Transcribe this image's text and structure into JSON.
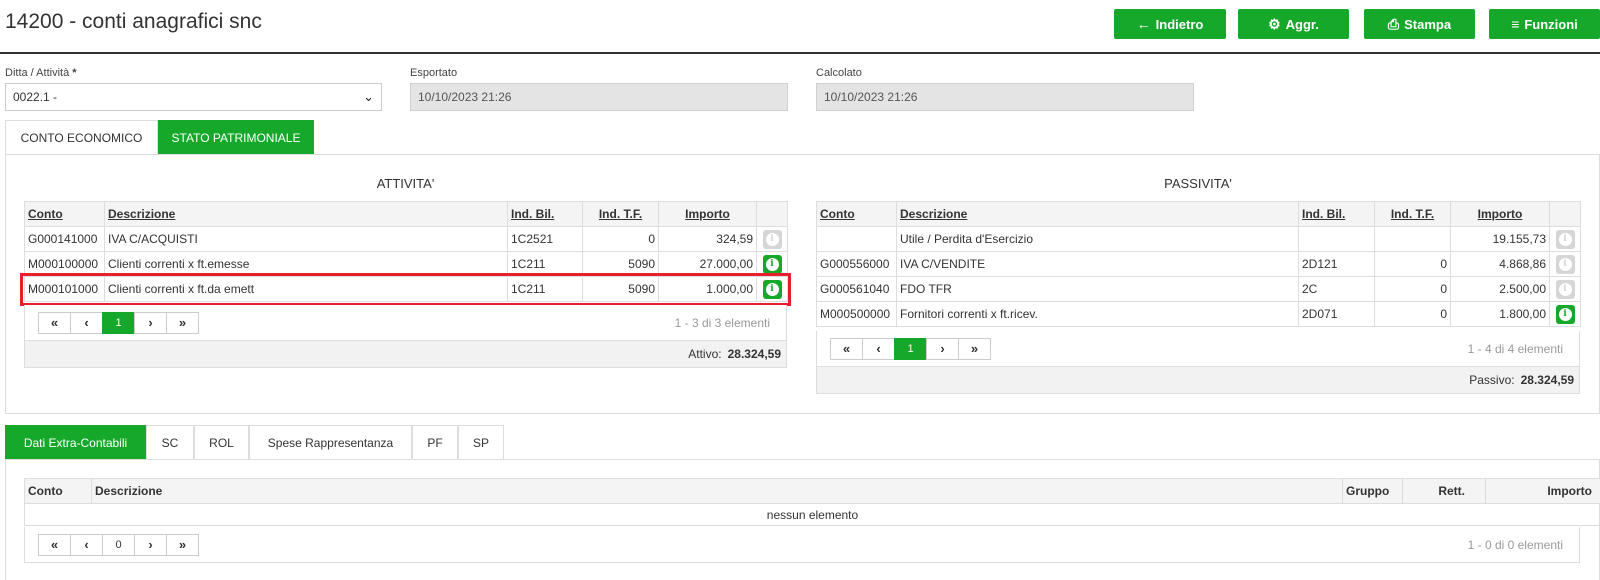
{
  "header": {
    "title": "14200 - conti anagrafici snc",
    "buttons": [
      {
        "icon": "arrow-left-icon",
        "label": "Indietro"
      },
      {
        "icon": "gears-icon",
        "label": "Aggr."
      },
      {
        "icon": "print-icon",
        "label": "Stampa"
      },
      {
        "icon": "bars-icon",
        "label": "Funzioni"
      }
    ]
  },
  "fields": {
    "ditta": {
      "label": "Ditta / Attività",
      "required": "*",
      "value": "0022.1 -"
    },
    "esportato": {
      "label": "Esportato",
      "value": "10/10/2023 21:26"
    },
    "calcolato": {
      "label": "Calcolato",
      "value": "10/10/2023 21:26"
    }
  },
  "tabs": [
    "CONTO ECONOMICO",
    "STATO PATRIMONIALE"
  ],
  "active_tab": "STATO PATRIMONIALE",
  "attivita": {
    "title": "ATTIVITA'",
    "columns": [
      "Conto",
      "Descrizione",
      "Ind. Bil.",
      "Ind. T.F.",
      "Importo"
    ],
    "rows": [
      {
        "conto": "G000141000",
        "descrizione": "IVA C/ACQUISTI",
        "ind_bil": "1C2521",
        "ind_tf": "0",
        "importo": "324,59",
        "info_enabled": false
      },
      {
        "conto": "M000100000",
        "descrizione": "Clienti correnti x ft.emesse",
        "ind_bil": "1C211",
        "ind_tf": "5090",
        "importo": "27.000,00",
        "info_enabled": true
      },
      {
        "conto": "M000101000",
        "descrizione": "Clienti correnti x ft.da emett",
        "ind_bil": "1C211",
        "ind_tf": "5090",
        "importo": "1.000,00",
        "info_enabled": true,
        "highlighted": true
      }
    ],
    "pager": {
      "first": "«",
      "prev": "‹",
      "page": "1",
      "next": "›",
      "last": "»",
      "info": "1 - 3 di 3 elementi"
    },
    "total_label": "Attivo:",
    "total_value": "28.324,59"
  },
  "passivita": {
    "title": "PASSIVITA'",
    "columns": [
      "Conto",
      "Descrizione",
      "Ind. Bil.",
      "Ind. T.F.",
      "Importo"
    ],
    "rows": [
      {
        "conto": "",
        "descrizione": "Utile / Perdita d'Esercizio",
        "ind_bil": "",
        "ind_tf": "",
        "importo": "19.155,73",
        "info_enabled": false
      },
      {
        "conto": "G000556000",
        "descrizione": "IVA C/VENDITE",
        "ind_bil": "2D121",
        "ind_tf": "0",
        "importo": "4.868,86",
        "info_enabled": false
      },
      {
        "conto": "G000561040",
        "descrizione": "FDO TFR",
        "ind_bil": "2C",
        "ind_tf": "0",
        "importo": "2.500,00",
        "info_enabled": false
      },
      {
        "conto": "M000500000",
        "descrizione": "Fornitori correnti x ft.ricev.",
        "ind_bil": "2D071",
        "ind_tf": "0",
        "importo": "1.800,00",
        "info_enabled": true
      }
    ],
    "pager": {
      "first": "«",
      "prev": "‹",
      "page": "1",
      "next": "›",
      "last": "»",
      "info": "1 - 4 di 4 elementi"
    },
    "total_label": "Passivo:",
    "total_value": "28.324,59"
  },
  "bottom_tabs": [
    "Dati Extra-Contabili",
    "SC",
    "ROL",
    "Spese Rappresentanza",
    "PF",
    "SP"
  ],
  "bottom_active_tab": "Dati Extra-Contabili",
  "extra": {
    "columns": [
      "Conto",
      "Descrizione",
      "Gruppo",
      "Rett.",
      "Importo"
    ],
    "empty_text": "nessun elemento",
    "pager": {
      "first": "«",
      "prev": "‹",
      "page": "0",
      "next": "›",
      "last": "»",
      "info": "1 - 0 di 0 elementi"
    }
  },
  "colors": {
    "accent": "#16a82a",
    "highlight": "#e51f2b"
  }
}
